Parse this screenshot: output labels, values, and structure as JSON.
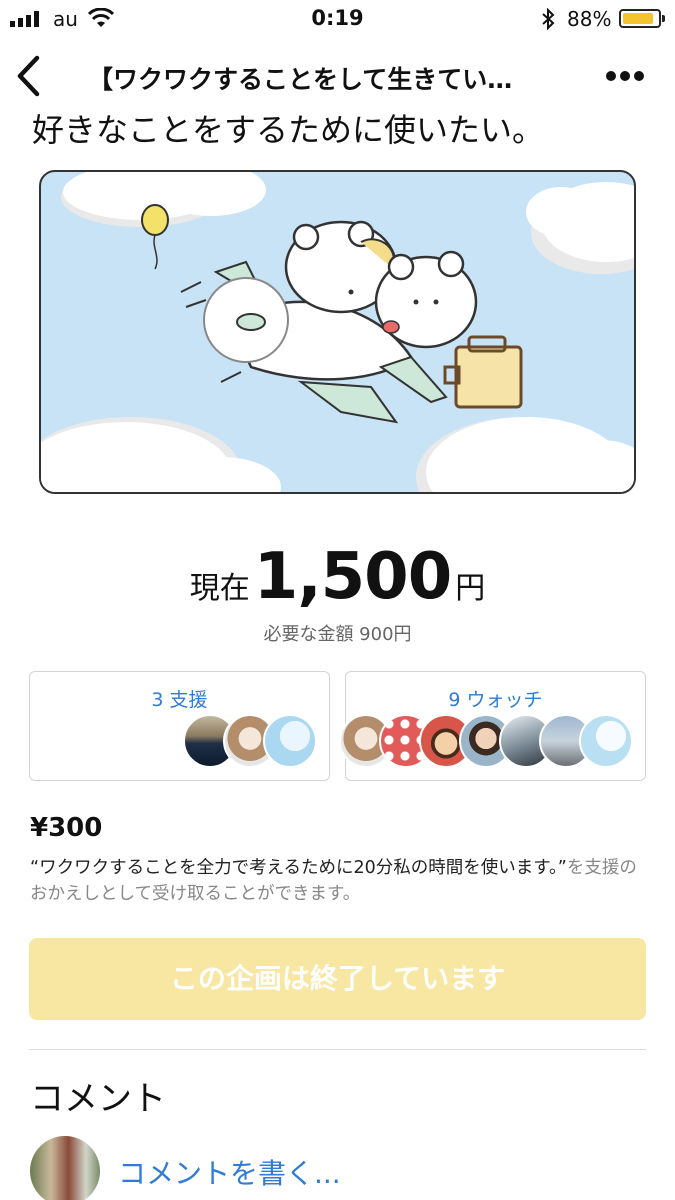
{
  "status_bar": {
    "carrier": "au",
    "time": "0:19",
    "battery_percent": "88%",
    "battery_level": 0.88,
    "battery_color": "#f4c430"
  },
  "nav": {
    "title": "【ワクワクすることをして生きてい…",
    "back_icon": "chevron-left-icon",
    "more_icon": "more-horizontal-icon"
  },
  "content": {
    "cut_heading": "好きなことをするために使いたい。",
    "funding": {
      "label": "現在",
      "amount": "1,500",
      "unit": "円",
      "required": "必要な金額 900円"
    },
    "support_card": {
      "title": "3 支援",
      "avatar_count": 3
    },
    "watch_card": {
      "title": "9 ウォッチ",
      "avatar_count": 7
    },
    "reward": {
      "price": "¥300",
      "description_main": "“ワクワクすることを全力で考えるために20分私の時間を使います。”",
      "description_suffix": "を支援のおかえしとして受け取ることができます。"
    },
    "ended_button": "この企画は終了しています",
    "comment_heading": "コメント",
    "write_comment": "コメントを書く..."
  },
  "colors": {
    "accent_blue": "#2f7bd6",
    "ended_button_bg": "#f7e7a2",
    "sky": "#c8e3f6"
  }
}
